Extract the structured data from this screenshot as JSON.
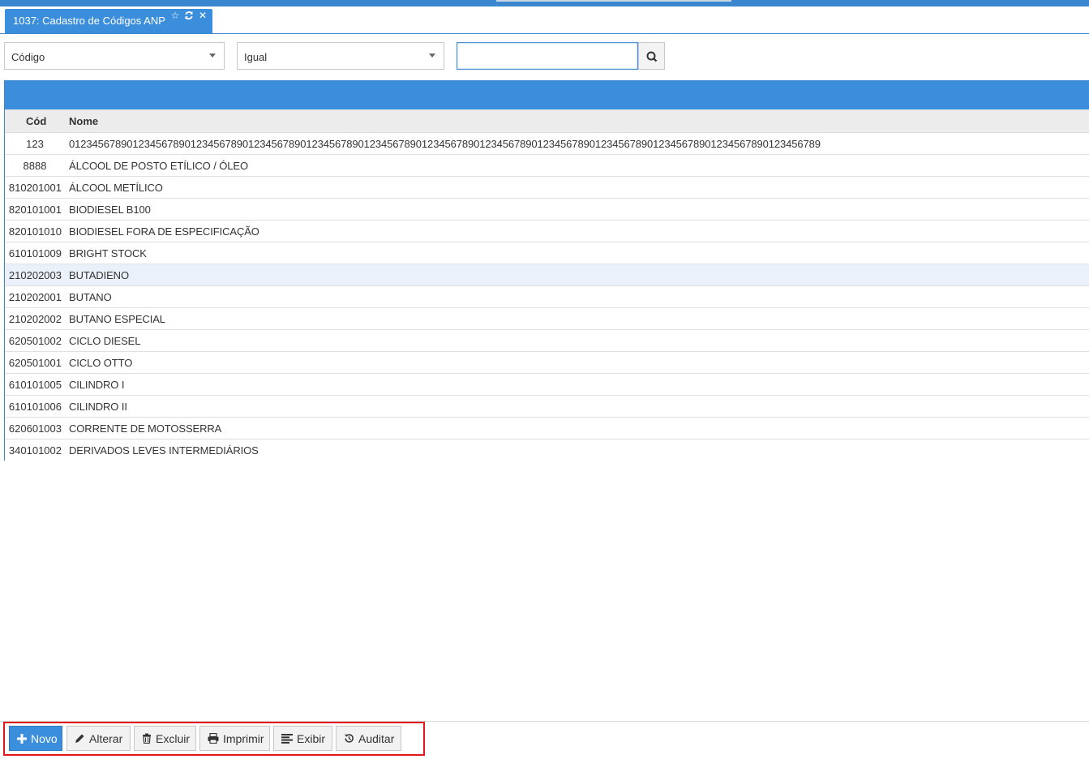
{
  "tab": {
    "title": "1037: Cadastro de Códigos ANP"
  },
  "filters": {
    "field": "Código",
    "operator": "Igual",
    "search_value": ""
  },
  "grid": {
    "columns": [
      "Cód",
      "Nome"
    ],
    "rows": [
      {
        "cod": "123",
        "nome": "0123456789012345678901234567890123456789012345678901234567890123456789012345678901234567890123456789012345678901234567890123456789"
      },
      {
        "cod": "8888",
        "nome": "ÁLCOOL DE POSTO ETÍLICO / ÓLEO"
      },
      {
        "cod": "810201001",
        "nome": "ÁLCOOL METÍLICO"
      },
      {
        "cod": "820101001",
        "nome": "BIODIESEL B100"
      },
      {
        "cod": "820101010",
        "nome": "BIODIESEL FORA DE ESPECIFICAÇÃO"
      },
      {
        "cod": "610101009",
        "nome": "BRIGHT STOCK"
      },
      {
        "cod": "210202003",
        "nome": "BUTADIENO"
      },
      {
        "cod": "210202001",
        "nome": "BUTANO"
      },
      {
        "cod": "210202002",
        "nome": "BUTANO ESPECIAL"
      },
      {
        "cod": "620501002",
        "nome": "CICLO DIESEL"
      },
      {
        "cod": "620501001",
        "nome": "CICLO OTTO"
      },
      {
        "cod": "610101005",
        "nome": "CILINDRO I"
      },
      {
        "cod": "610101006",
        "nome": "CILINDRO II"
      },
      {
        "cod": "620601003",
        "nome": "CORRENTE DE MOTOSSERRA"
      },
      {
        "cod": "340101002",
        "nome": "DERIVADOS LEVES INTERMEDIÁRIOS"
      }
    ]
  },
  "toolbar": {
    "novo": "Novo",
    "alterar": "Alterar",
    "excluir": "Excluir",
    "imprimir": "Imprimir",
    "exibir": "Exibir",
    "auditar": "Auditar"
  },
  "colors": {
    "accent": "#3a8edb",
    "highlight": "#e4141b"
  }
}
